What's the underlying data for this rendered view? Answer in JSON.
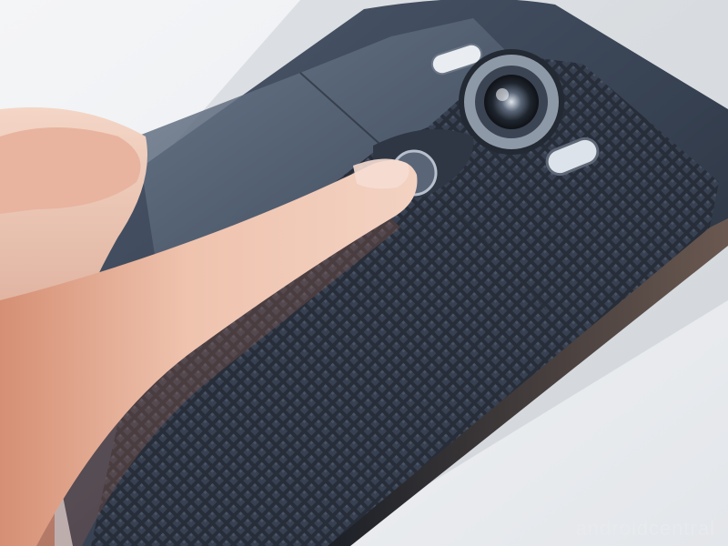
{
  "scene": {
    "subject": "phone-back-with-finger",
    "colors": {
      "background": "#eceef1",
      "phone_body": "#3d4a5c",
      "phone_texture": "#2c333f",
      "camera_ring": "#8e99a8",
      "skin": "#e6b7a3"
    }
  },
  "watermark": {
    "text": "androidcentral",
    "icon": "logo-watermark"
  }
}
